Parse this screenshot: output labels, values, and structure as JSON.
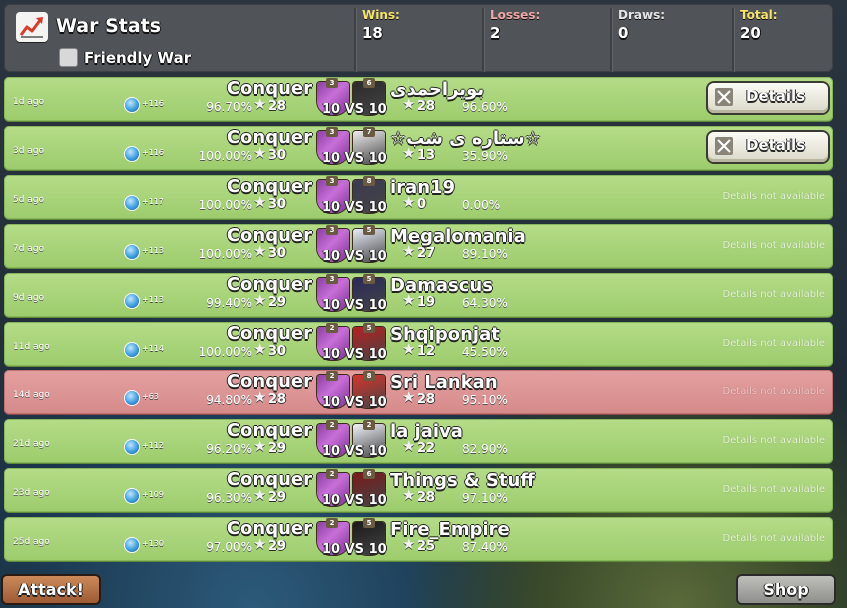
{
  "header": {
    "title": "War Stats",
    "friendly_war_label": "Friendly War",
    "friendly_war_checked": false,
    "stats": [
      {
        "label": "Wins:",
        "value": "18",
        "color": "#f5e36a"
      },
      {
        "label": "Losses:",
        "value": "2",
        "color": "#f0a7a7"
      },
      {
        "label": "Draws:",
        "value": "0",
        "color": "#e6e6e6"
      },
      {
        "label": "Total:",
        "value": "20",
        "color": "#f5e36a"
      }
    ]
  },
  "details_label": "Details",
  "not_available_label": "Details not available",
  "wars": [
    {
      "ago": "1d ago",
      "trophies": "+116",
      "result": "Conquer",
      "our_pct": "96.70%",
      "our_stars": "28",
      "our_level": "3",
      "opp_level": "6",
      "size_label": "10 VS 10",
      "opponent": "بوير‌احمدی",
      "opp_stars": "28",
      "opp_pct": "96.60%",
      "details": true,
      "loss": false,
      "opp_badge": "#2b2b2b"
    },
    {
      "ago": "3d ago",
      "trophies": "+116",
      "result": "Conquer",
      "our_pct": "100.00%",
      "our_stars": "30",
      "our_level": "3",
      "opp_level": "7",
      "size_label": "10 VS 10",
      "opponent": "☆ستاره ی شب☆",
      "opp_stars": "13",
      "opp_pct": "35.90%",
      "details": true,
      "loss": false,
      "opp_badge": "#eeeeee"
    },
    {
      "ago": "5d ago",
      "trophies": "+117",
      "result": "Conquer",
      "our_pct": "100.00%",
      "our_stars": "30",
      "our_level": "3",
      "opp_level": "8",
      "size_label": "10 VS 10",
      "opponent": "iran19",
      "opp_stars": "0",
      "opp_pct": "0.00%",
      "details": false,
      "loss": false,
      "opp_badge": "#3a3a52"
    },
    {
      "ago": "7d ago",
      "trophies": "+113",
      "result": "Conquer",
      "our_pct": "100.00%",
      "our_stars": "30",
      "our_level": "3",
      "opp_level": "5",
      "size_label": "10 VS 10",
      "opponent": "Megalomania",
      "opp_stars": "27",
      "opp_pct": "89.10%",
      "details": false,
      "loss": false,
      "opp_badge": "#e8eef8"
    },
    {
      "ago": "9d ago",
      "trophies": "+113",
      "result": "Conquer",
      "our_pct": "99.40%",
      "our_stars": "29",
      "our_level": "3",
      "opp_level": "5",
      "size_label": "10 VS 10",
      "opponent": "Damascus",
      "opp_stars": "19",
      "opp_pct": "64.30%",
      "details": false,
      "loss": false,
      "opp_badge": "#2a2a5a"
    },
    {
      "ago": "11d ago",
      "trophies": "+114",
      "result": "Conquer",
      "our_pct": "100.00%",
      "our_stars": "30",
      "our_level": "2",
      "opp_level": "5",
      "size_label": "10 VS 10",
      "opponent": "Shqiponjat",
      "opp_stars": "12",
      "opp_pct": "45.50%",
      "details": false,
      "loss": false,
      "opp_badge": "#b82020"
    },
    {
      "ago": "14d ago",
      "trophies": "+63",
      "result": "Conquer",
      "our_pct": "94.80%",
      "our_stars": "28",
      "our_level": "2",
      "opp_level": "8",
      "size_label": "10 VS 10",
      "opponent": "Sri Lankan",
      "opp_stars": "28",
      "opp_pct": "95.10%",
      "details": false,
      "loss": true,
      "opp_badge": "#d8342c"
    },
    {
      "ago": "21d ago",
      "trophies": "+112",
      "result": "Conquer",
      "our_pct": "96.20%",
      "our_stars": "29",
      "our_level": "2",
      "opp_level": "2",
      "size_label": "10 VS 10",
      "opponent": "la jaiva",
      "opp_stars": "22",
      "opp_pct": "82.90%",
      "details": false,
      "loss": false,
      "opp_badge": "#f0f4fa"
    },
    {
      "ago": "23d ago",
      "trophies": "+109",
      "result": "Conquer",
      "our_pct": "96.30%",
      "our_stars": "29",
      "our_level": "2",
      "opp_level": "6",
      "size_label": "10 VS 10",
      "opponent": "Things & Stuff",
      "opp_stars": "28",
      "opp_pct": "97.10%",
      "details": false,
      "loss": false,
      "opp_badge": "#7a1a1a"
    },
    {
      "ago": "25d ago",
      "trophies": "+130",
      "result": "Conquer",
      "our_pct": "97.00%",
      "our_stars": "29",
      "our_level": "2",
      "opp_level": "5",
      "size_label": "10 VS 10",
      "opponent": "Fire_Empire",
      "opp_stars": "25",
      "opp_pct": "87.40%",
      "details": false,
      "loss": false,
      "opp_badge": "#1a1a1a"
    }
  ],
  "footer": {
    "attack_label": "Attack!",
    "shop_label": "Shop"
  }
}
